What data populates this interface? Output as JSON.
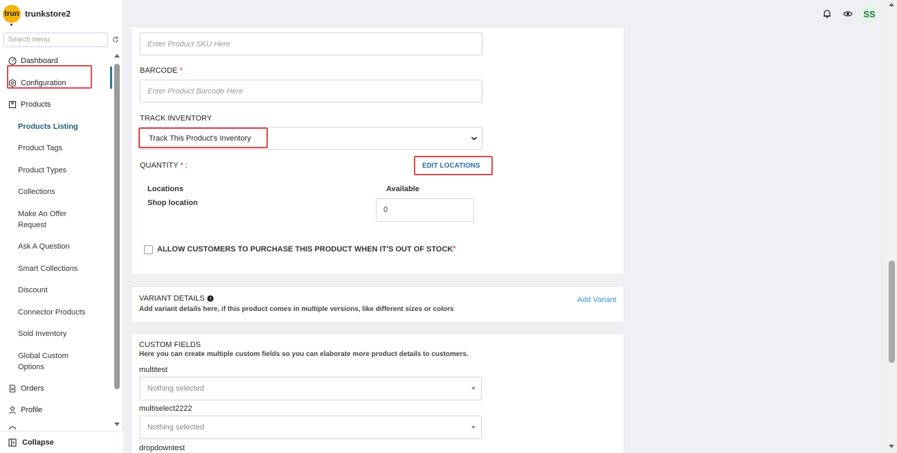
{
  "brand": {
    "logo_text": "trun",
    "name": "trunkstore2"
  },
  "sidebar": {
    "search_placeholder": "Search menu",
    "menu": [
      {
        "label": "Dashboard",
        "icon": "dashboard-icon"
      },
      {
        "label": "Configuration",
        "icon": "gear-icon"
      },
      {
        "label": "Products",
        "icon": "box-icon"
      }
    ],
    "submenu": [
      {
        "label": "Products Listing",
        "active": true
      },
      {
        "label": "Product Tags"
      },
      {
        "label": "Product Types"
      },
      {
        "label": "Collections"
      },
      {
        "label": "Make An Offer Request"
      },
      {
        "label": "Ask A Question"
      },
      {
        "label": "Smart Collections"
      },
      {
        "label": "Discount"
      },
      {
        "label": "Connector Products"
      },
      {
        "label": "Sold Inventory"
      },
      {
        "label": "Global Custom Options"
      }
    ],
    "bottom_menu": [
      {
        "label": "Orders",
        "icon": "document-icon"
      },
      {
        "label": "Profile",
        "icon": "user-icon"
      }
    ],
    "collapse_label": "Collapse"
  },
  "header": {
    "avatar_initials": "SS"
  },
  "inventory": {
    "sku_placeholder": "Enter Product SKU Here",
    "barcode_label": "BARCODE",
    "barcode_required": "*",
    "barcode_placeholder": "Enter Product Barcode Here",
    "track_label": "TRACK INVENTORY",
    "track_value": "Track This Product's Inventory",
    "quantity_label": "QUANTITY",
    "quantity_required": "*",
    "quantity_colon": ":",
    "edit_locations": "EDIT LOCATIONS",
    "col_locations": "Locations",
    "col_available": "Available",
    "location_name": "Shop location",
    "location_qty": "0",
    "oos_label": "ALLOW CUSTOMERS TO PURCHASE THIS PRODUCT WHEN IT'S OUT OF STOCK",
    "oos_required": "*"
  },
  "variants": {
    "title": "VARIANT DETAILS",
    "description": "Add variant details here, if this product comes in multiple versions, like different sizes or colors",
    "add_label": "Add Variant"
  },
  "custom_fields": {
    "title": "CUSTOM FIELDS",
    "description": "Here you can create multiple custom fields so you can elaborate more product details to customers.",
    "fields": [
      {
        "label": "multitest",
        "value": "Nothing selected"
      },
      {
        "label": "multiselect2222",
        "value": "Nothing selected"
      },
      {
        "label": "dropdowntest"
      }
    ]
  }
}
